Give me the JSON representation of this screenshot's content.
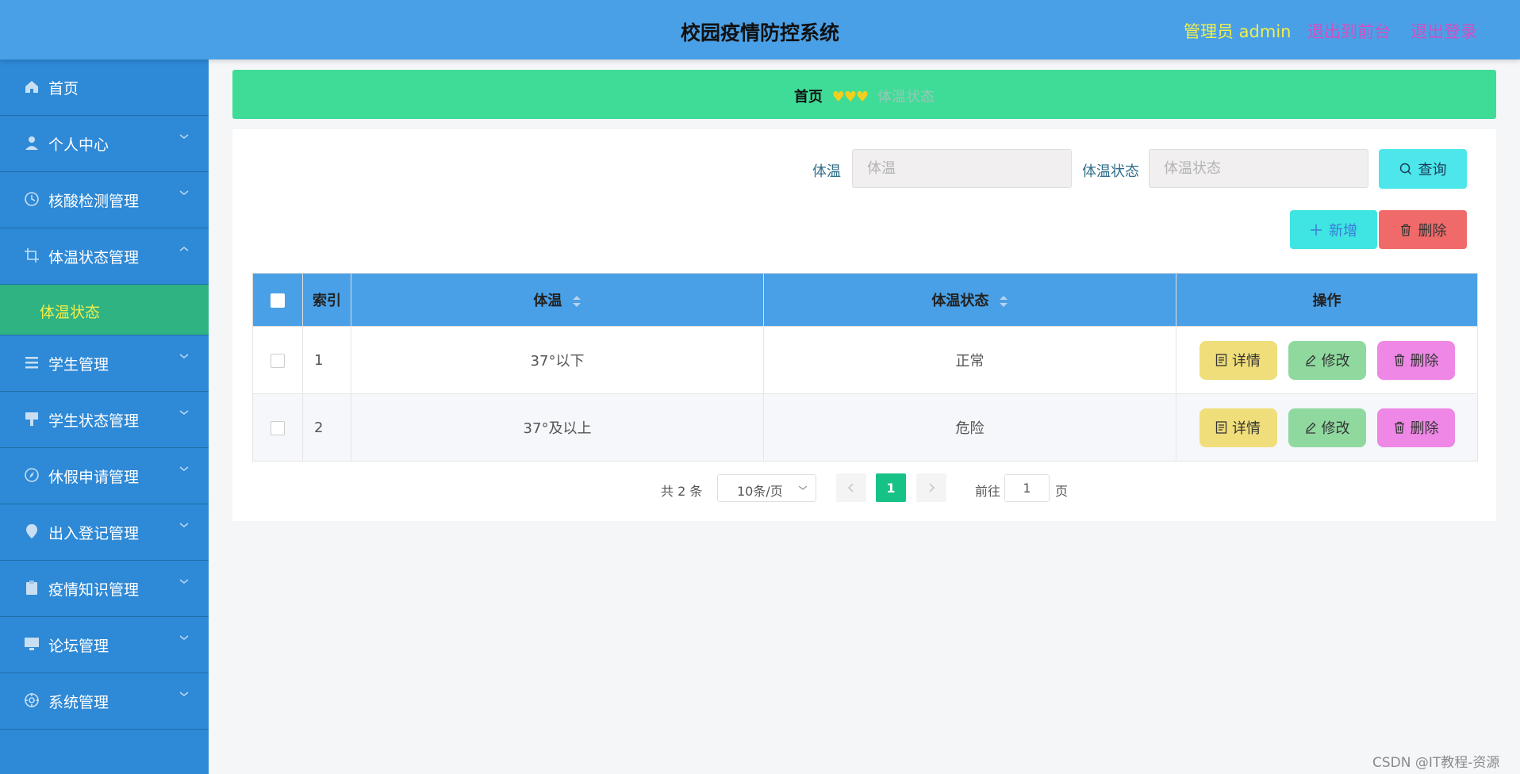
{
  "header": {
    "title": "校园疫情防控系统",
    "admin_label": "管理员 admin",
    "to_front_label": "退出到前台",
    "logout_label": "退出登录"
  },
  "sidebar": {
    "items": [
      {
        "label": "首页",
        "icon": "home-icon"
      },
      {
        "label": "个人中心",
        "icon": "user-icon"
      },
      {
        "label": "核酸检测管理",
        "icon": "clock-icon"
      },
      {
        "label": "体温状态管理",
        "icon": "crop-icon"
      },
      {
        "label": "学生管理",
        "icon": "menu-icon"
      },
      {
        "label": "学生状态管理",
        "icon": "brush-icon"
      },
      {
        "label": "休假申请管理",
        "icon": "compass-icon"
      },
      {
        "label": "出入登记管理",
        "icon": "location-icon"
      },
      {
        "label": "疫情知识管理",
        "icon": "clipboard-icon"
      },
      {
        "label": "论坛管理",
        "icon": "monitor-icon"
      },
      {
        "label": "系统管理",
        "icon": "gear-icon"
      }
    ],
    "submenu_label": "体温状态"
  },
  "breadcrumb": {
    "home": "首页",
    "hearts": "♥♥♥",
    "current": "体温状态"
  },
  "search": {
    "temp_label": "体温",
    "temp_placeholder": "体温",
    "status_label": "体温状态",
    "status_placeholder": "体温状态",
    "query_label": "查询"
  },
  "actions": {
    "add_label": "新增",
    "delete_label": "删除"
  },
  "table": {
    "headers": {
      "index": "索引",
      "temperature": "体温",
      "status": "体温状态",
      "ops": "操作"
    },
    "rows": [
      {
        "index": "1",
        "temperature": "37°以下",
        "status": "正常"
      },
      {
        "index": "2",
        "temperature": "37°及以上",
        "status": "危险"
      }
    ],
    "op_labels": {
      "detail": "详情",
      "edit": "修改",
      "delete": "删除"
    }
  },
  "pagination": {
    "total_text": "共 2 条",
    "page_size": "10条/页",
    "current_page": "1",
    "goto_label": "前往",
    "goto_value": "1",
    "page_suffix": "页"
  },
  "watermark": "CSDN @IT教程-资源",
  "colors": {
    "header_bg": "#4aa0e6",
    "sidebar_bg": "#2e89d6",
    "submenu_bg": "#2fb383",
    "breadcrumb_bg": "#3fdc97",
    "accent_page": "#17c287"
  }
}
